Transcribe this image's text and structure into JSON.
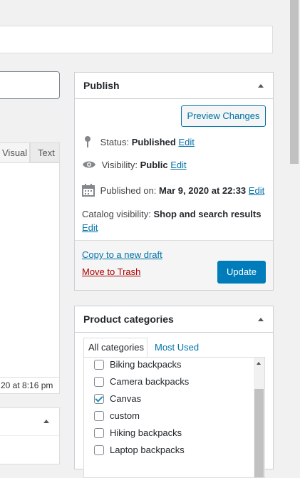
{
  "editor": {
    "tab_visual": "Visual",
    "tab_text": "Text",
    "last_edited": "20 at 8:16 pm"
  },
  "publish": {
    "title": "Publish",
    "preview_label": "Preview Changes",
    "status_label": "Status:",
    "status_value": "Published",
    "visibility_label": "Visibility:",
    "visibility_value": "Public",
    "published_on_label": "Published on:",
    "published_on_value": "Mar 9, 2020 at 22:33",
    "catalog_label": "Catalog visibility:",
    "catalog_value": "Shop and search results",
    "edit_label": "Edit",
    "copy_draft": "Copy to a new draft",
    "move_trash": "Move to Trash",
    "update_label": "Update"
  },
  "categories": {
    "title": "Product categories",
    "tab_all": "All categories",
    "tab_most_used": "Most Used",
    "items": [
      {
        "label": "Biking backpacks",
        "checked": false
      },
      {
        "label": "Camera backpacks",
        "checked": false
      },
      {
        "label": "Canvas",
        "checked": true
      },
      {
        "label": "custom",
        "checked": false
      },
      {
        "label": "Hiking backpacks",
        "checked": false
      },
      {
        "label": "Laptop backpacks",
        "checked": false
      }
    ]
  },
  "colors": {
    "primary": "#007cba",
    "link": "#0073aa",
    "danger": "#a00000",
    "panel_border": "#ccd0d4"
  },
  "icons": {
    "status": "pin-icon",
    "visibility": "eye-icon",
    "published_on": "calendar-icon",
    "collapse": "triangle-up-icon"
  }
}
